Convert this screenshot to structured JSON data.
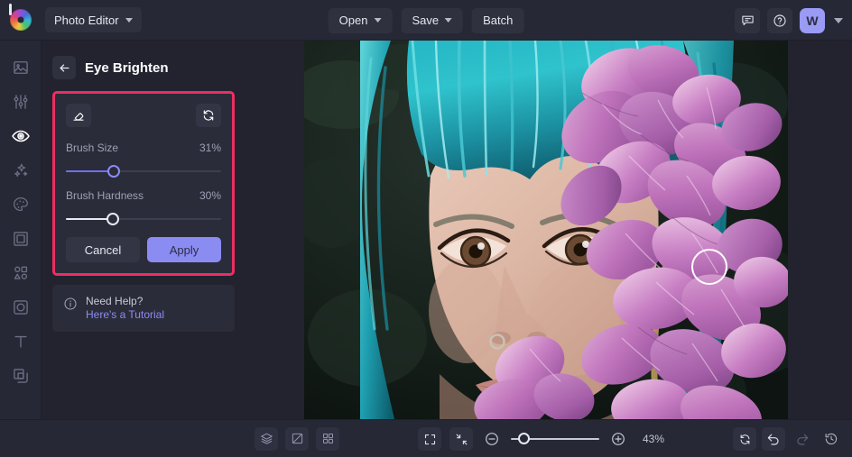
{
  "topbar": {
    "logo_name": "befunky-logo",
    "app_menu_label": "Photo Editor",
    "open_label": "Open",
    "save_label": "Save",
    "batch_label": "Batch",
    "feedback_icon": "comment-icon",
    "help_icon": "question-circle-icon",
    "avatar_initial": "W",
    "avatar_color": "#9a9bf5"
  },
  "sidebar": {
    "items": [
      {
        "name": "sidebar-item-image",
        "icon": "image-icon",
        "active": false
      },
      {
        "name": "sidebar-item-edit",
        "icon": "sliders-icon",
        "active": false
      },
      {
        "name": "sidebar-item-touch-up",
        "icon": "eye-icon",
        "active": true
      },
      {
        "name": "sidebar-item-effects",
        "icon": "sparkles-icon",
        "active": false
      },
      {
        "name": "sidebar-item-artsy",
        "icon": "palette-icon",
        "active": false
      },
      {
        "name": "sidebar-item-frames",
        "icon": "frame-icon",
        "active": false
      },
      {
        "name": "sidebar-item-graphics",
        "icon": "shapes-icon",
        "active": false
      },
      {
        "name": "sidebar-item-overlays",
        "icon": "overlay-icon",
        "active": false
      },
      {
        "name": "sidebar-item-text",
        "icon": "text-t-icon",
        "active": false
      },
      {
        "name": "sidebar-item-layers",
        "icon": "layers-copy-icon",
        "active": false
      }
    ]
  },
  "panel": {
    "back_icon": "arrow-left-icon",
    "title": "Eye Brighten",
    "highlight_color": "#ef2d63",
    "tools": {
      "eraser_icon": "eraser-icon",
      "reset_icon": "reset-circular-arrows-icon"
    },
    "sliders": [
      {
        "label": "Brush Size",
        "value": "31%",
        "percent": 31,
        "fill": "#6f70e8"
      },
      {
        "label": "Brush Hardness",
        "value": "30%",
        "percent": 30,
        "fill": "#e9e9f2"
      }
    ],
    "cancel_label": "Cancel",
    "apply_label": "Apply",
    "apply_color": "#8b8cf2",
    "help": {
      "info_icon": "info-circle-icon",
      "line1": "Need Help?",
      "line2": "Here's a Tutorial",
      "link_color": "#8b8cf2"
    }
  },
  "canvas": {
    "photo_alt": "Woman with teal hair and purple bougainvillea flowers",
    "brush_cursor_icon": "brush-circle-cursor"
  },
  "bottombar": {
    "left_tools": [
      {
        "name": "layers-button",
        "icon": "layers-icon"
      },
      {
        "name": "compare-button",
        "icon": "compare-split-icon"
      },
      {
        "name": "grid-button",
        "icon": "grid-four-icon"
      }
    ],
    "view_tools": [
      {
        "name": "fullscreen-button",
        "icon": "expand-corners-icon"
      },
      {
        "name": "fit-screen-button",
        "icon": "collapse-arrows-icon"
      }
    ],
    "zoom_out_icon": "minus-circle-icon",
    "zoom_in_icon": "plus-circle-icon",
    "zoom_percent": "43%",
    "right_tools": [
      {
        "name": "reset-button",
        "icon": "reset-circular-arrows-icon",
        "dim": false
      },
      {
        "name": "undo-button",
        "icon": "undo-arrow-icon",
        "dim": false
      },
      {
        "name": "redo-button",
        "icon": "redo-arrow-icon",
        "dim": true
      },
      {
        "name": "history-button",
        "icon": "history-clock-icon",
        "dim": false
      }
    ]
  }
}
